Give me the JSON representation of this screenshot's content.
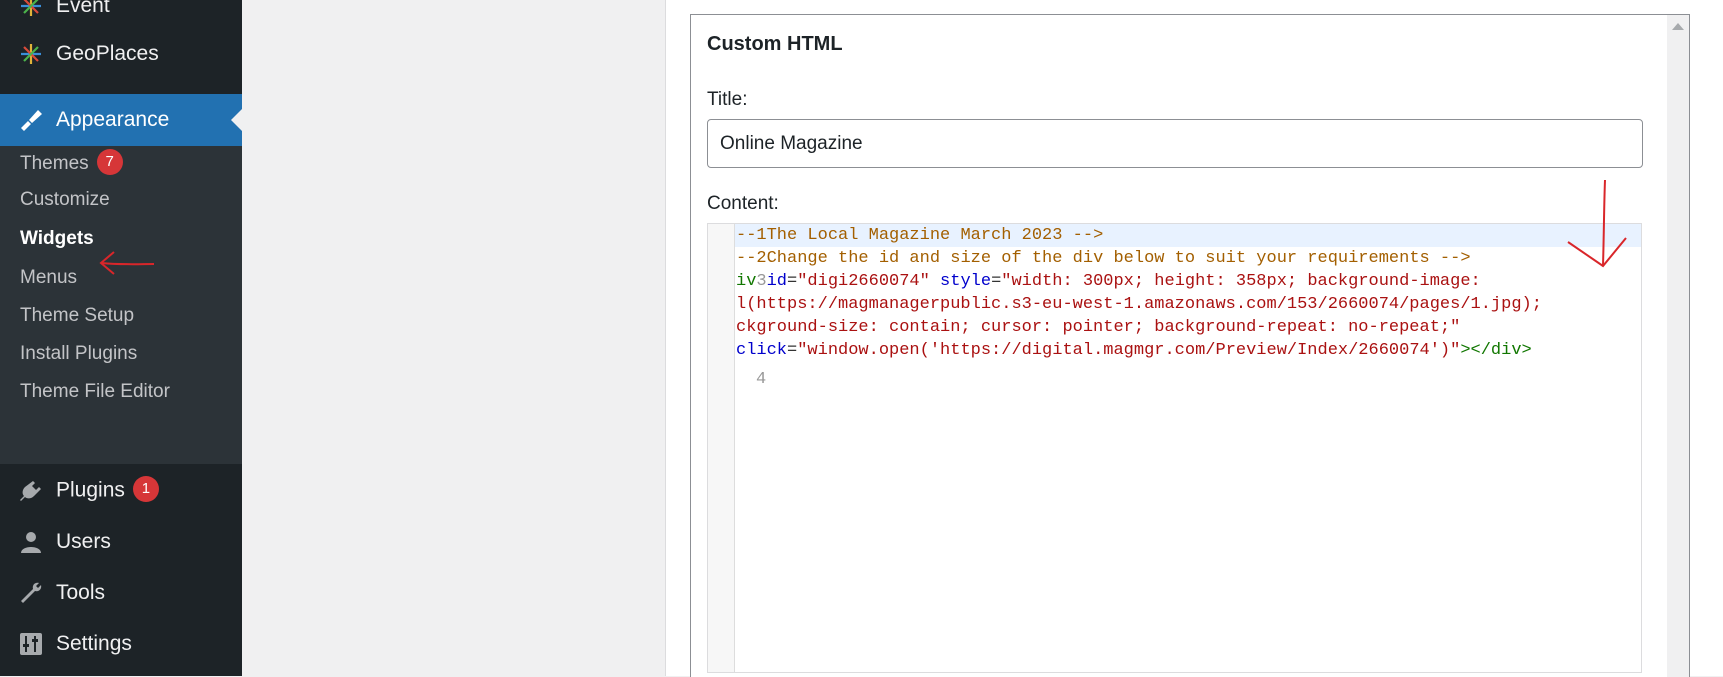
{
  "sidebar": {
    "items_top": [
      {
        "label": "Event",
        "icon": "event-star-icon"
      },
      {
        "label": "GeoPlaces",
        "icon": "geoplaces-star-icon"
      }
    ],
    "appearance": {
      "label": "Appearance",
      "icon": "paintbrush-icon"
    },
    "submenu": [
      {
        "label": "Themes",
        "badge": "7"
      },
      {
        "label": "Customize"
      },
      {
        "label": "Widgets"
      },
      {
        "label": "Menus"
      },
      {
        "label": "Theme Setup"
      },
      {
        "label": "Install Plugins"
      },
      {
        "label": "Theme File Editor"
      }
    ],
    "items_bottom": [
      {
        "label": "Plugins",
        "badge": "1",
        "icon": "plug-icon"
      },
      {
        "label": "Users",
        "icon": "user-icon"
      },
      {
        "label": "Tools",
        "icon": "wrench-icon"
      },
      {
        "label": "Settings",
        "icon": "settings-sliders-icon"
      }
    ]
  },
  "widget": {
    "title": "Custom HTML",
    "title_label": "Title:",
    "title_value": "Online Magazine",
    "content_label": "Content:",
    "code": {
      "line1": {
        "prefix": "--1",
        "text": "The Local Magazine March 2023 -->"
      },
      "line2": {
        "prefix": "--2",
        "text": "Change the id and size of the div below to suit your requirements -->"
      },
      "line3": {
        "tag_frag": "iv",
        "num": "3",
        "attr1": "id",
        "eq1": "=",
        "val1": "\"digi2660074\"",
        "attr2": "style",
        "eq2": "=",
        "val2": "\"width: 300px; height: 358px; background-image:"
      },
      "line3b": "l(https://magmanagerpublic.s3-eu-west-1.amazonaws.com/153/2660074/pages/1.jpg);",
      "line3c": "ckground-size: contain; cursor: pointer; background-repeat: no-repeat;\"",
      "line3d": {
        "attr": "click",
        "eq": "=",
        "val": "\"window.open('https://digital.magmgr.com/Preview/Index/2660074')\"",
        "close_gt": ">",
        "close_tag": "</div>"
      },
      "line4_num": "4"
    }
  },
  "colors": {
    "sidebar_bg": "#1d2327",
    "submenu_bg": "#2c3338",
    "active_blue": "#2271b1",
    "badge_red": "#d63638",
    "annotation_red": "#d9262a"
  }
}
